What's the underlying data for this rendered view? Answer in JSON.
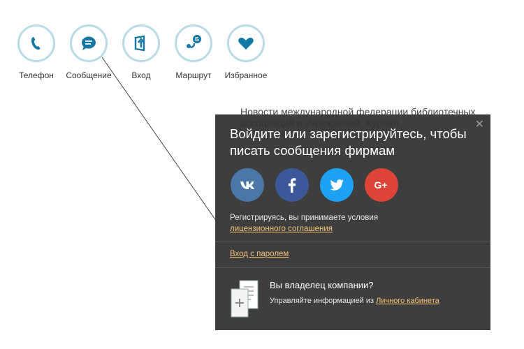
{
  "actions": [
    {
      "label": "Телефон",
      "icon": "phone-icon"
    },
    {
      "label": "Сообщение",
      "icon": "message-icon"
    },
    {
      "label": "Вход",
      "icon": "entrance-icon"
    },
    {
      "label": "Маршрут",
      "icon": "route-icon"
    },
    {
      "label": "Избранное",
      "icon": "heart-icon"
    }
  ],
  "background": {
    "partial_text": "Новости международной федерации библиотечных ассоциаций и учреждений, журнал"
  },
  "popup": {
    "close_symbol": "✕",
    "title": "Войдите или зарегистрируйтесь, чтобы писать сообщения фирмам",
    "socials": [
      {
        "name": "vk-icon",
        "color": "#4a76a8"
      },
      {
        "name": "facebook-icon",
        "color": "#3b5998"
      },
      {
        "name": "twitter-icon",
        "color": "#1da1f2"
      },
      {
        "name": "google-plus-icon",
        "color": "#db4437"
      }
    ],
    "terms_text": "Регистрируясь, вы принимаете условия",
    "terms_link": "лицензионного соглашения",
    "password_login": "Вход с паролем",
    "owner_title": "Вы владелец компании?",
    "owner_text": "Управляйте информацией из",
    "owner_link": "Личного кабинета"
  },
  "colors": {
    "icon_blue": "#1577a6",
    "ring": "#b9dbe8",
    "popup_bg": "#343434",
    "link": "#f3c27a"
  }
}
